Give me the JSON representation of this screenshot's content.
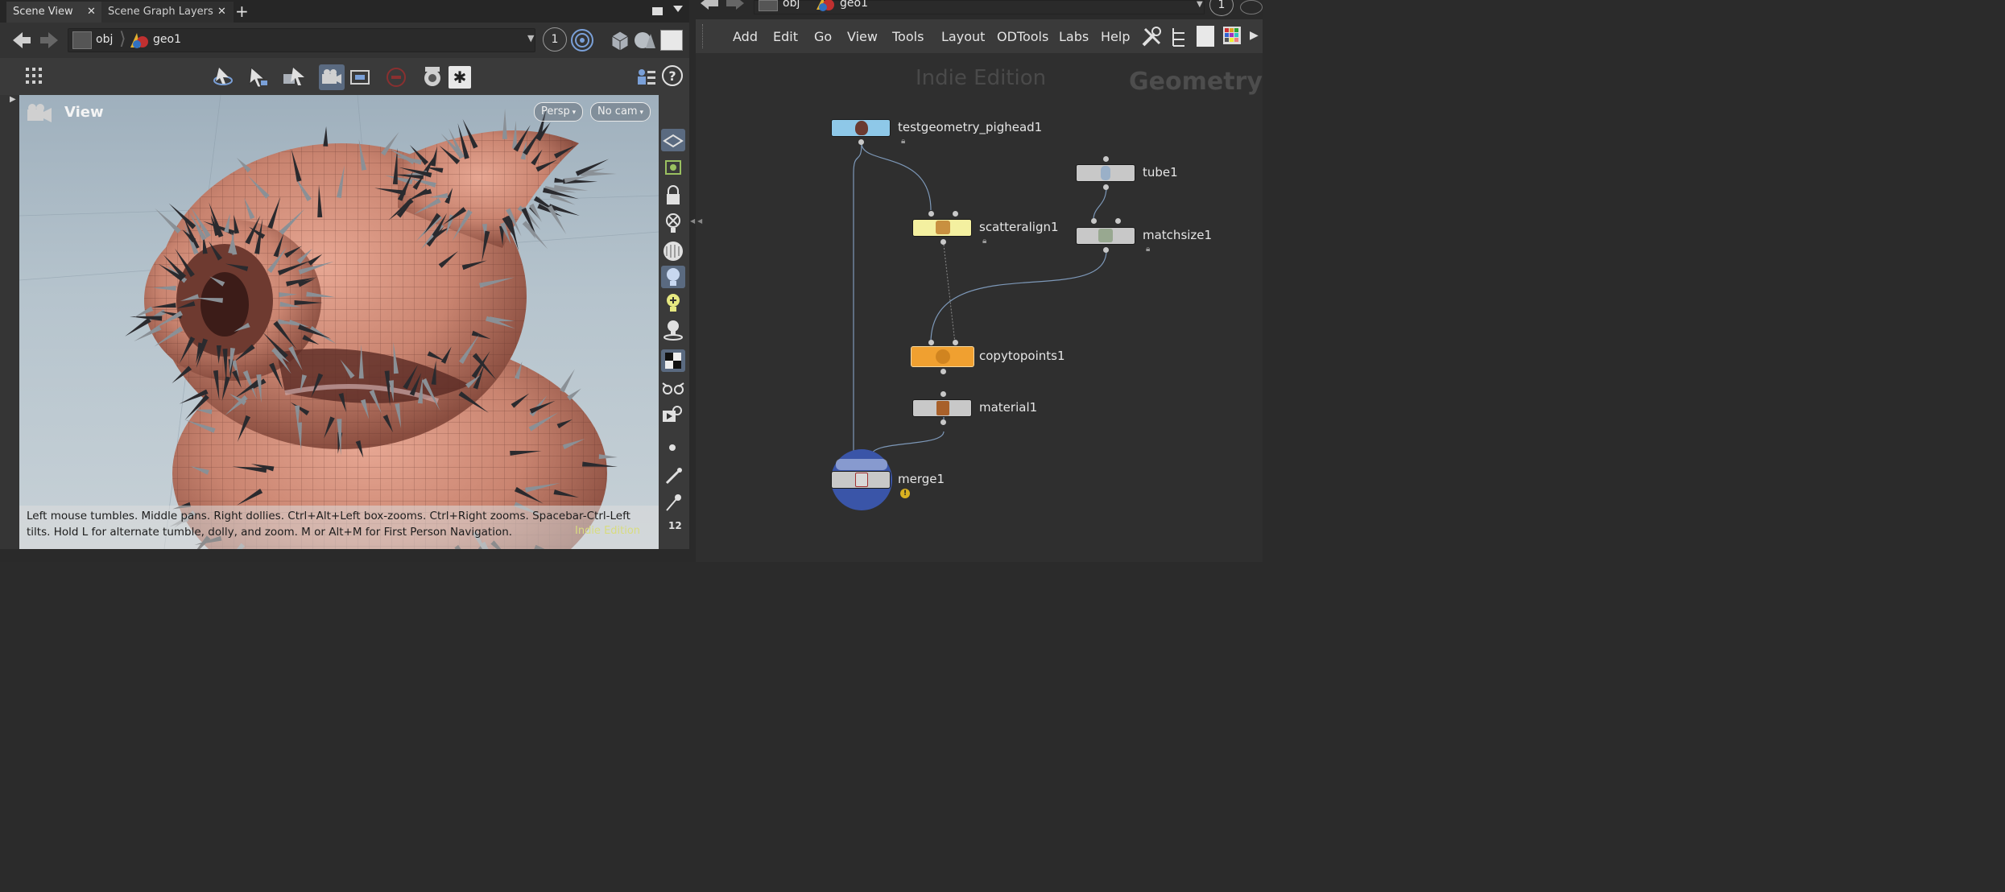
{
  "left_pane": {
    "tabs": [
      {
        "label": "Scene View",
        "close": "✕"
      },
      {
        "label": "Scene Graph Layers",
        "close": "✕"
      }
    ],
    "add_tab": "+",
    "path": {
      "network": "obj",
      "node": "geo1"
    },
    "viewer_number": "1",
    "view_title": "View",
    "perspective_menu": "Persp",
    "camera_menu": "No cam",
    "hint_line1": "Left mouse tumbles. Middle pans. Right dollies. Ctrl+Alt+Left box-zooms. Ctrl+Right zooms. Spacebar-Ctrl-Left",
    "hint_line2": "tilts. Hold L for alternate tumble, dolly, and zoom. M or Alt+M for First Person Navigation.",
    "indie_watermark": "Indie Edition",
    "bottom_number": "12"
  },
  "right_pane": {
    "path": {
      "network": "obj",
      "node": "geo1"
    },
    "viewer_number": "1",
    "menu": [
      "Add",
      "Edit",
      "Go",
      "View",
      "Tools",
      "Layout",
      "ODTools",
      "Labs",
      "Help"
    ],
    "watermark_edition": "Indie Edition",
    "watermark_context": "Geometry",
    "nodes": [
      {
        "name": "testgeometry_pighead1",
        "color": "#8ec8e8",
        "icon": "pighead-icon"
      },
      {
        "name": "tube1",
        "color": "#c8c8c8",
        "icon": "tube-icon"
      },
      {
        "name": "scatteralign1",
        "color": "#f4f0a0",
        "icon": "scatter-icon"
      },
      {
        "name": "matchsize1",
        "color": "#c8c8c8",
        "icon": "matchsize-icon"
      },
      {
        "name": "copytopoints1",
        "color": "#f0a030",
        "icon": "copy-icon"
      },
      {
        "name": "material1",
        "color": "#c8c8c8",
        "icon": "material-icon"
      },
      {
        "name": "merge1",
        "color": "#c8c8c8",
        "icon": "merge-icon"
      }
    ],
    "merge_warning": "!"
  },
  "colors": {
    "accent_selected": "#f0a030",
    "viewport_sky": "#b6c4cd",
    "pig_skin": "#c98470",
    "spike": "#8a9096"
  }
}
